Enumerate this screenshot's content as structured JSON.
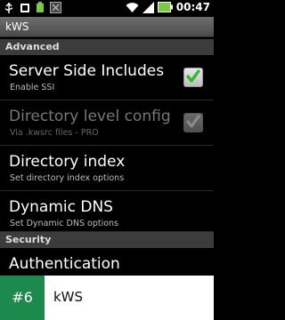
{
  "status_bar": {
    "time": "00:47",
    "left_icons": [
      "usb-icon",
      "notification-icon",
      "battery-saver-icon",
      "app-icon"
    ],
    "right_icons": [
      "wifi-icon",
      "signal-icon",
      "battery-icon"
    ]
  },
  "app_title": "kWS",
  "sections": [
    {
      "header": "Advanced",
      "items": [
        {
          "title": "Server Side Includes",
          "summary": "Enable SSI",
          "checkbox": true,
          "checked": true,
          "enabled": true
        },
        {
          "title": "Directory level config",
          "summary": "Via .kwsrc files - PRO",
          "checkbox": true,
          "checked": true,
          "enabled": false
        },
        {
          "title": "Directory index",
          "summary": "Set directory index options",
          "checkbox": false,
          "enabled": true
        },
        {
          "title": "Dynamic DNS",
          "summary": "Set Dynamic DNS options",
          "checkbox": false,
          "enabled": true
        }
      ]
    },
    {
      "header": "Security",
      "items": [
        {
          "title": "Authentication",
          "summary": "",
          "checkbox": false,
          "enabled": true
        }
      ]
    }
  ],
  "overlay": {
    "rank": "#6",
    "app_name": "kWS",
    "badge_color": "#1b8a4c"
  }
}
